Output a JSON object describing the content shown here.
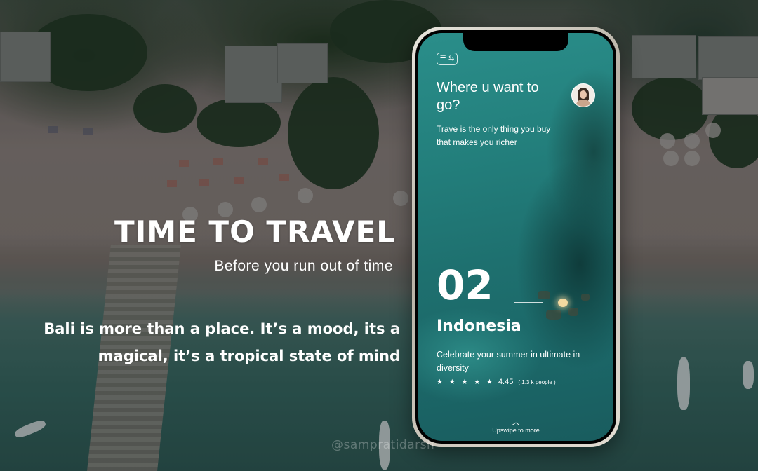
{
  "hero": {
    "title": "TIME TO TRAVEL",
    "subtitle": "Before you run out of time",
    "body": "Bali is more than a place. It’s a mood, its a magical, it’s a tropical state of mind"
  },
  "phone": {
    "menu_icon": "☰ ⇆",
    "question": "Where u want to go?",
    "tagline": "Trave is the only thing you buy that makes you richer",
    "number": "02",
    "country": "Indonesia",
    "description": "Celebrate your summer in ultimate in diversity",
    "stars": "★ ★ ★ ★ ★",
    "rating": "4.45",
    "rating_people": "( 1.3 k people )",
    "swipe_icon": "︿",
    "swipe_label": "Upswipe to more"
  },
  "watermark": "@sampratidarsh",
  "colors": {
    "accent": "#237f7c",
    "text": "#ffffff"
  }
}
